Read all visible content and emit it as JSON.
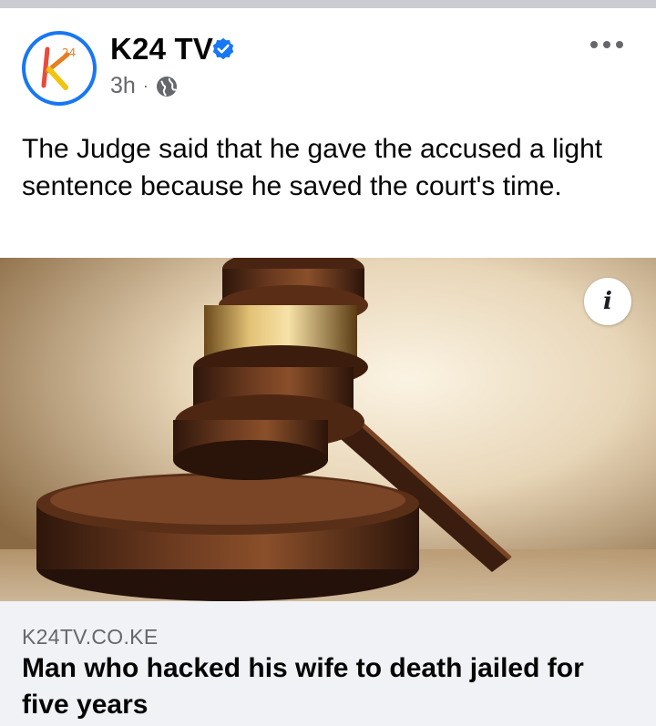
{
  "post": {
    "page_name": "K24 TV",
    "verified_icon": "verified-badge-icon",
    "time": "3h",
    "separator": "·",
    "audience_icon": "globe-icon",
    "more_icon": "more-options-icon",
    "caption": "The Judge said that he gave the accused a light sentence because he saved the court's time.",
    "avatar_logo_text": "24"
  },
  "link_preview": {
    "image_alt": "wooden-gavel-image",
    "info_label": "i",
    "domain": "K24TV.CO.KE",
    "title": "Man who hacked his wife to death jailed for five years"
  },
  "colors": {
    "accent": "#1877f2",
    "text_primary": "#050505",
    "text_secondary": "#65676b",
    "card_background": "#f0f2f5"
  }
}
